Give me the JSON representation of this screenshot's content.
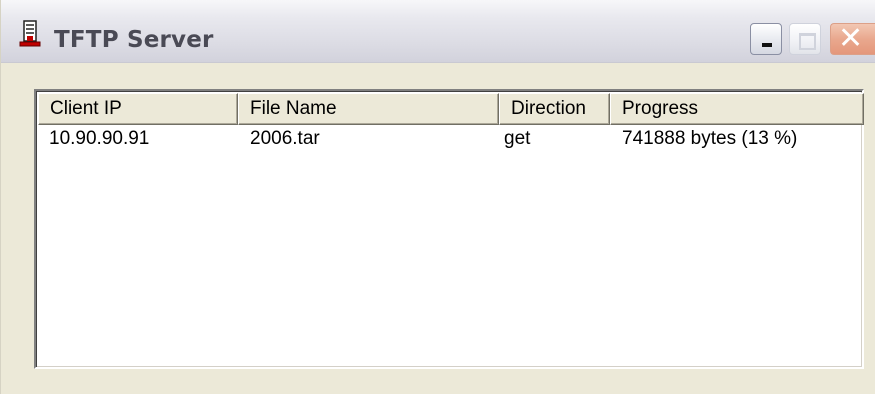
{
  "window": {
    "title": "TFTP Server",
    "icon": "tftp-app-icon",
    "controls": {
      "minimize_icon": "minimize-icon",
      "maximize_icon": "maximize-icon",
      "close_glyph": "✕"
    }
  },
  "table": {
    "columns": [
      "Client IP",
      "File Name",
      "Direction",
      "Progress"
    ],
    "rows": [
      {
        "client_ip": "10.90.90.91",
        "file_name": "2006.tar",
        "direction": "get",
        "progress": "741888 bytes (13 %)"
      }
    ]
  },
  "colors": {
    "window_face": "#ece9d8",
    "close_button": "#e4977b",
    "title_text": "#4a4a55"
  }
}
